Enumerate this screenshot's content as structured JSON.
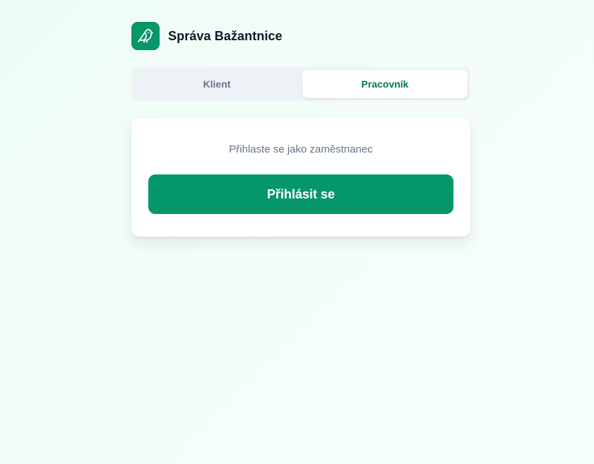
{
  "header": {
    "logo_icon": "bird-icon",
    "title": "Správa Bažantnice"
  },
  "tabs": [
    {
      "label": "Klient",
      "active": false
    },
    {
      "label": "Pracovník",
      "active": true
    }
  ],
  "card": {
    "prompt": "Přihlaste se jako zaměstnanec",
    "login_label": "Přihlásit se"
  },
  "colors": {
    "accent": "#059669",
    "active_tab_text": "#047857",
    "muted_text": "#64748b",
    "title_text": "#111827"
  }
}
